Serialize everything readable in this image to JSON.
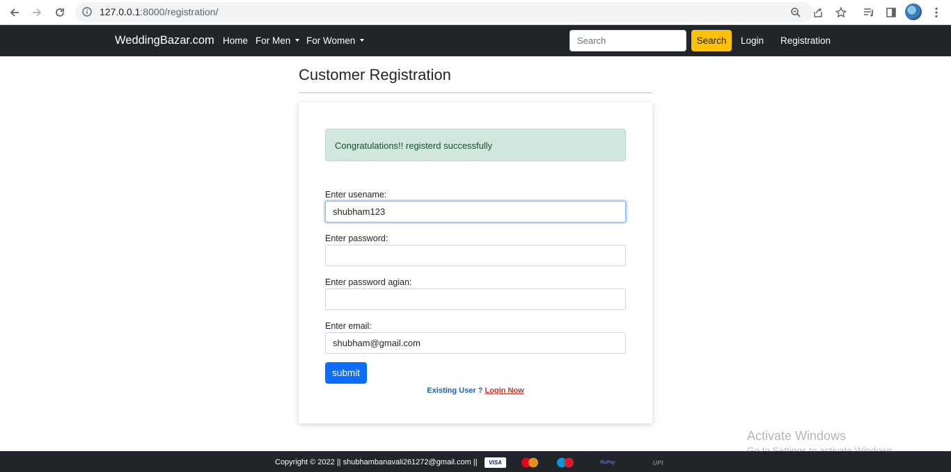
{
  "browser": {
    "url_host": "127.0.0.1",
    "url_rest": ":8000/registration/"
  },
  "navbar": {
    "brand": "WeddingBazar.com",
    "links": [
      "Home",
      "For Men",
      "For Women"
    ],
    "search_placeholder": "Search",
    "search_button": "Search",
    "login": "Login",
    "registration": "Registration"
  },
  "main": {
    "title": "Customer Registration",
    "alert": "Congratulations!! registerd successfully",
    "fields": [
      {
        "label": "Enter usename:",
        "value": ""
      },
      {
        "label": "Enter password:",
        "value": ""
      },
      {
        "label": "Enter password agian:",
        "value": ""
      },
      {
        "label": "Enter email:",
        "value": "shubham@gmail.com"
      }
    ],
    "username_value": "shubham123",
    "submit": "submit",
    "existing_user": "Existing User ?",
    "login_now": "Login Now"
  },
  "watermark": {
    "title": "Activate Windows",
    "subtitle": "Go to Settings to activate Windows."
  },
  "footer": {
    "copyright": "Copyright © 2022 || shubhambanavali261272@gmail.com ||",
    "payments": [
      "VISA",
      "MasterCard",
      "Maestro",
      "RuPay",
      "UPI"
    ]
  },
  "colors": {
    "navbar_bg": "#212529",
    "search_button": "#ffc107",
    "submit_button": "#0d6efd",
    "alert_bg": "#d1e7dd"
  }
}
